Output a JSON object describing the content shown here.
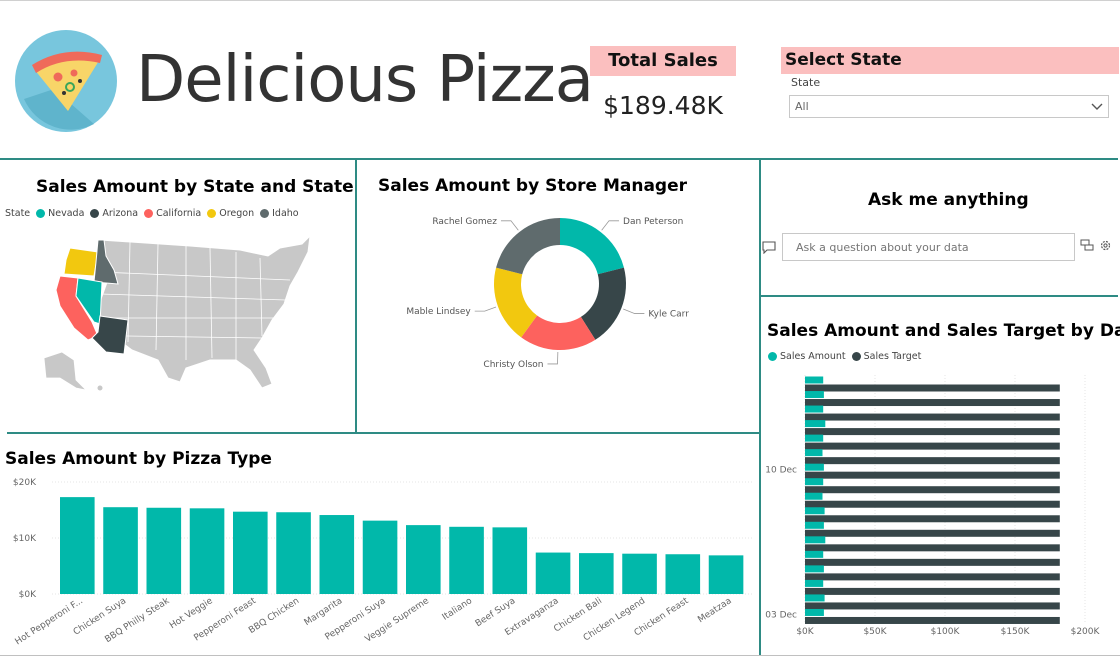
{
  "header": {
    "app_title": "Delicious Pizza",
    "total_sales_label": "Total Sales",
    "total_sales_value": "$189.48K",
    "select_state_label": "Select State",
    "slicer_field": "State",
    "slicer_value": "All"
  },
  "map_visual": {
    "title": "Sales Amount by State and State",
    "legend_title": "State",
    "legend": [
      {
        "name": "Nevada",
        "color": "#01b8aa"
      },
      {
        "name": "Arizona",
        "color": "#374649"
      },
      {
        "name": "California",
        "color": "#fd625e"
      },
      {
        "name": "Oregon",
        "color": "#f2c80f"
      },
      {
        "name": "Idaho",
        "color": "#5f6b6d"
      }
    ]
  },
  "qa_visual": {
    "title": "Ask me anything",
    "placeholder": "Ask a question about your data"
  },
  "chart_data": [
    {
      "type": "pie",
      "title": "Sales Amount by Store Manager",
      "categories": [
        "Dan Peterson",
        "Kyle Carr",
        "Christy Olson",
        "Mable Lindsey",
        "Rachel Gomez"
      ],
      "values": [
        21,
        20,
        19,
        19,
        21
      ],
      "colors": [
        "#01b8aa",
        "#374649",
        "#fd625e",
        "#f2c80f",
        "#5f6b6d"
      ]
    },
    {
      "type": "bar",
      "title": "Sales Amount by Pizza Type",
      "categories": [
        "Hot Pepperoni F...",
        "Chicken Suya",
        "BBQ Philly Steak",
        "Hot Veggie",
        "Pepperoni Feast",
        "BBQ Chicken",
        "Margarita",
        "Pepperoni Suya",
        "Veggie Supreme",
        "Italiano",
        "Beef Suya",
        "Extravaganza",
        "Chicken Bali",
        "Chicken Legend",
        "Chicken Feast",
        "Meatzaa"
      ],
      "values": [
        17300,
        15500,
        15400,
        15300,
        14700,
        14600,
        14100,
        13100,
        12300,
        12000,
        11900,
        7400,
        7300,
        7200,
        7100,
        6900
      ],
      "yticks": [
        "$0K",
        "$10K",
        "$20K"
      ],
      "ylim": [
        0,
        20000
      ],
      "color": "#01b8aa"
    },
    {
      "type": "bar",
      "orientation": "horizontal",
      "title": "Sales Amount and Sales Target by Date",
      "series": [
        {
          "name": "Sales Amount",
          "color": "#01b8aa",
          "values": [
            13000,
            13500,
            13000,
            14500,
            13000,
            12500,
            13500,
            13000,
            12500,
            14000,
            13500,
            14500,
            13000,
            13500,
            13000,
            14000,
            13500
          ]
        },
        {
          "name": "Sales Target",
          "color": "#374649",
          "values": [
            182000,
            182000,
            182000,
            182000,
            182000,
            182000,
            182000,
            182000,
            182000,
            182000,
            182000,
            182000,
            182000,
            182000,
            182000,
            182000,
            182000
          ]
        }
      ],
      "ytick_labels": [
        {
          "label": "10 Dec",
          "index": 6
        },
        {
          "label": "03 Dec",
          "index": 16
        }
      ],
      "xticks": [
        "$0K",
        "$50K",
        "$100K",
        "$150K",
        "$200K"
      ],
      "xlim": [
        0,
        200000
      ]
    }
  ]
}
